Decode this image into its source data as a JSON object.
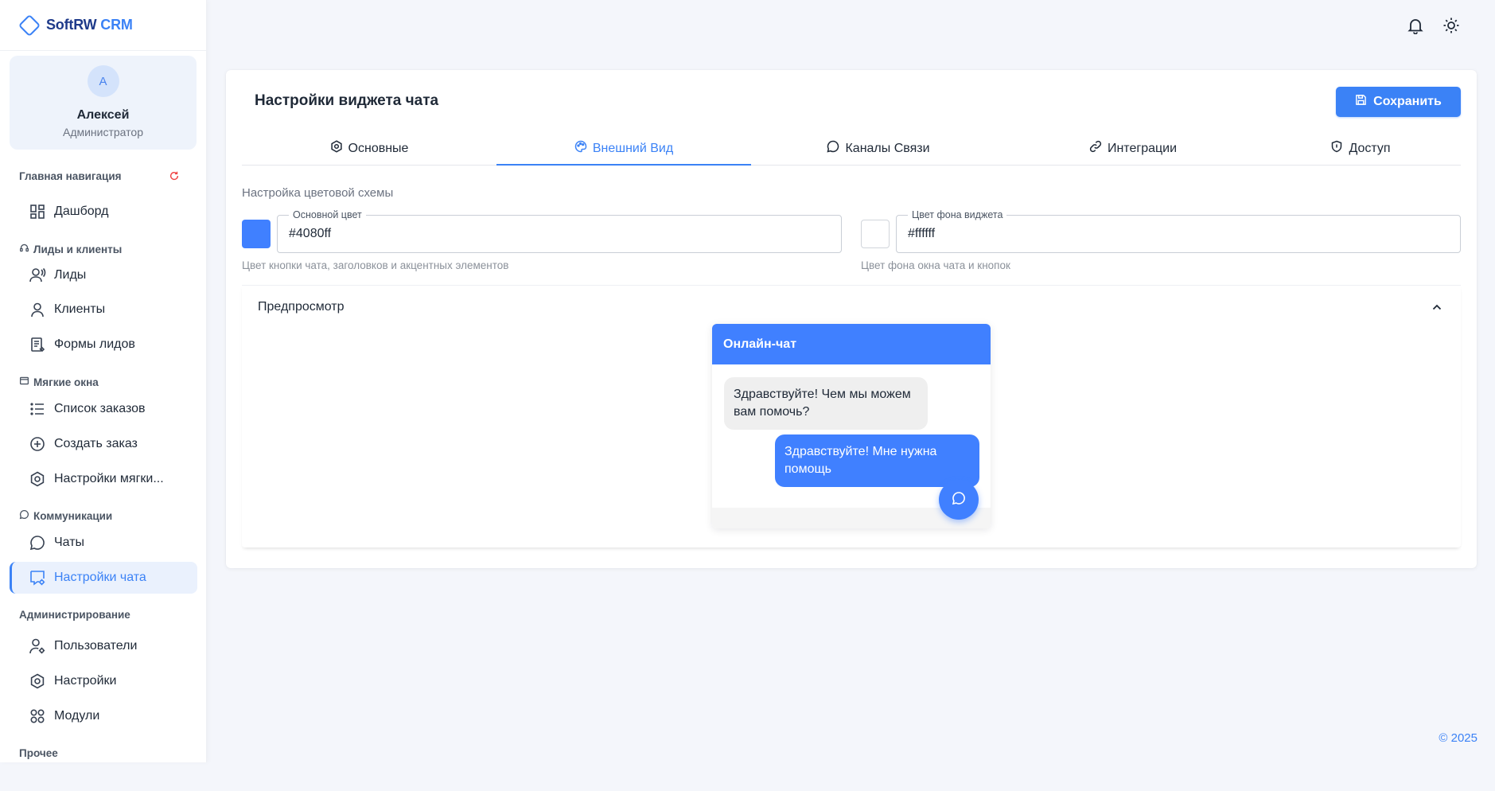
{
  "brand": {
    "name": "SoftRW",
    "suffix": "CRM"
  },
  "profile": {
    "initial": "A",
    "name": "Алексей",
    "role": "Администратор"
  },
  "sidebar": {
    "sections": [
      {
        "label": "Главная навигация"
      },
      {
        "label": "Лиды и клиенты"
      },
      {
        "label": "Мягкие окна"
      },
      {
        "label": "Коммуникации"
      },
      {
        "label": "Администрирование"
      },
      {
        "label": "Прочее"
      }
    ],
    "items": [
      {
        "label": "Дашборд",
        "icon": "dashboard-icon"
      },
      {
        "label": "Лиды",
        "icon": "leads-icon"
      },
      {
        "label": "Клиенты",
        "icon": "user-icon"
      },
      {
        "label": "Формы лидов",
        "icon": "form-icon"
      },
      {
        "label": "Список заказов",
        "icon": "list-icon"
      },
      {
        "label": "Создать заказ",
        "icon": "plus-circle-icon"
      },
      {
        "label": "Настройки мягки...",
        "icon": "gear-icon"
      },
      {
        "label": "Чаты",
        "icon": "chat-icon"
      },
      {
        "label": "Настройки чата",
        "icon": "chat-settings-icon",
        "active": true
      },
      {
        "label": "Пользователи",
        "icon": "user-gear-icon"
      },
      {
        "label": "Настройки",
        "icon": "gear-icon"
      },
      {
        "label": "Модули",
        "icon": "modules-icon"
      }
    ]
  },
  "header": {
    "icons": [
      "bell-icon",
      "sun-icon"
    ]
  },
  "page": {
    "title": "Настройки виджета чата",
    "save_label": "Сохранить",
    "tabs": [
      {
        "label": "Основные",
        "icon": "settings-hex-icon"
      },
      {
        "label": "Внешний Вид",
        "icon": "palette-icon",
        "active": true
      },
      {
        "label": "Каналы Связи",
        "icon": "chat-icon"
      },
      {
        "label": "Интеграции",
        "icon": "link-icon"
      },
      {
        "label": "Доступ",
        "icon": "shield-icon"
      }
    ]
  },
  "appearance": {
    "section_label": "Настройка цветовой схемы",
    "primary": {
      "legend": "Основной цвет",
      "value": "#4080ff",
      "hint": "Цвет кнопки чата, заголовков и акцентных элементов"
    },
    "background": {
      "legend": "Цвет фона виджета",
      "value": "#ffffff",
      "hint": "Цвет фона окна чата и кнопок"
    }
  },
  "preview": {
    "title": "Предпросмотр",
    "chat_title": "Онлайн-чат",
    "incoming": "Здравствуйте! Чем мы можем вам помочь?",
    "outgoing": "Здравствуйте! Мне нужна помощь"
  },
  "footer": {
    "copyright": "© 2025"
  },
  "colors": {
    "accent": "#3b82f6",
    "widget_primary": "#4080ff",
    "widget_bg": "#ffffff"
  }
}
